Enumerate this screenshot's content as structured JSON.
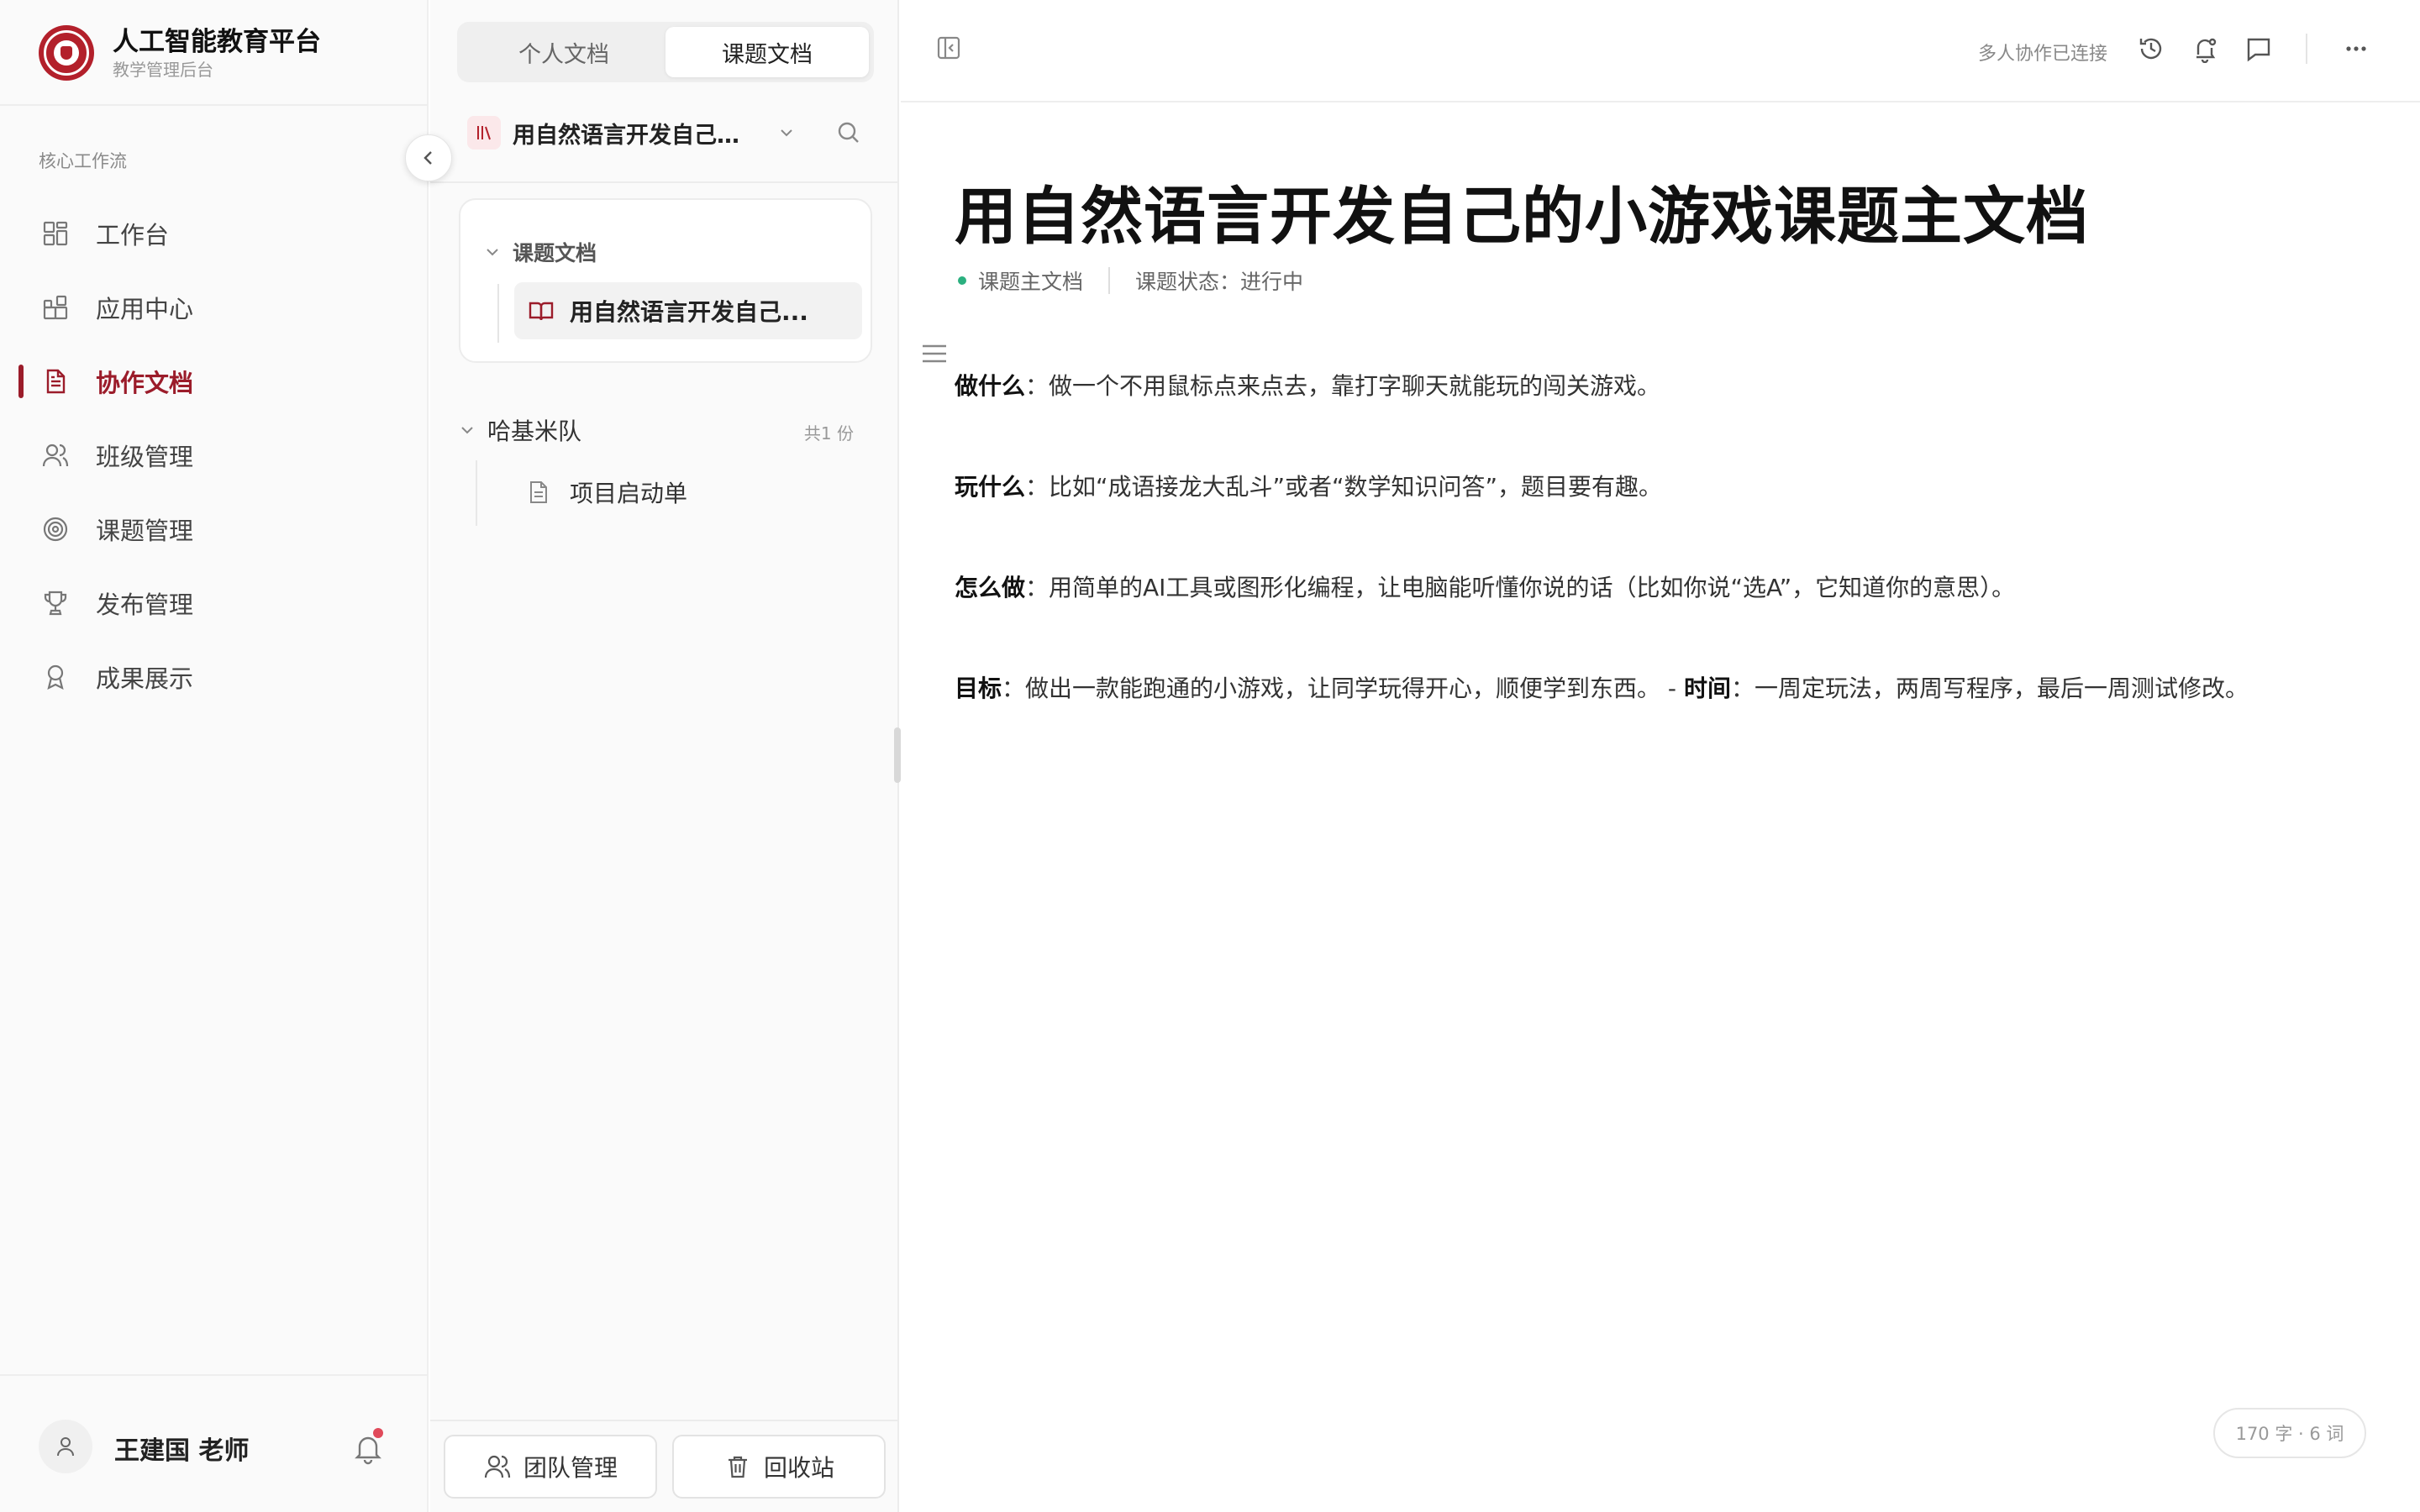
{
  "brand": {
    "title": "人工智能教育平台",
    "subtitle": "教学管理后台",
    "color": "#b3202b"
  },
  "sidebar": {
    "section_title": "核心工作流",
    "items": [
      {
        "label": "工作台",
        "icon": "dashboard-icon",
        "active": false
      },
      {
        "label": "应用中心",
        "icon": "apps-icon",
        "active": false
      },
      {
        "label": "协作文档",
        "icon": "document-icon",
        "active": true
      },
      {
        "label": "班级管理",
        "icon": "users-icon",
        "active": false
      },
      {
        "label": "课题管理",
        "icon": "target-icon",
        "active": false
      },
      {
        "label": "发布管理",
        "icon": "trophy-icon",
        "active": false
      },
      {
        "label": "成果展示",
        "icon": "medal-icon",
        "active": false
      }
    ],
    "accent": "#9b1c2a"
  },
  "user": {
    "name": "王建国 老师",
    "has_notification": true
  },
  "tree": {
    "tabs": [
      {
        "label": "个人文档",
        "active": false
      },
      {
        "label": "课题文档",
        "active": true
      }
    ],
    "project_name": "用自然语言开发自己的...",
    "card_group": "课题文档",
    "card_leaf": "用自然语言开发自己...",
    "team_group": "哈基米队",
    "team_count": "共1 份",
    "team_doc": "项目启动单",
    "team_manage_label": "团队管理",
    "recycle_label": "回收站"
  },
  "editor": {
    "collab_status": "多人协作已连接",
    "title": "用自然语言开发自己的小游戏课题主文档",
    "meta_type": "课题主文档",
    "meta_status": "课题状态：进行中",
    "paragraphs": [
      {
        "label": "做什么",
        "sep": "：",
        "text": "做一个不用鼠标点来点去，靠打字聊天就能玩的闯关游戏。"
      },
      {
        "label": "玩什么",
        "sep": "：",
        "text": "比如“成语接龙大乱斗”或者“数学知识问答”，题目要有趣。"
      },
      {
        "label": "怎么做",
        "sep": "：",
        "text": "用简单的AI工具或图形化编程，让电脑能听懂你说的话（比如你说“选A”，它知道你的意思）。"
      }
    ],
    "last_paragraph": {
      "label": "目标",
      "sep": "：",
      "text": "做出一款能跑通的小游戏，让同学玩得开心，顺便学到东西。 - ",
      "label2": "时间",
      "sep2": "：",
      "text2": "一周定玩法，两周写程序，最后一周测试修改。"
    },
    "word_count": "170 字 · 6 词",
    "status_dot_color": "#2bb07f"
  }
}
